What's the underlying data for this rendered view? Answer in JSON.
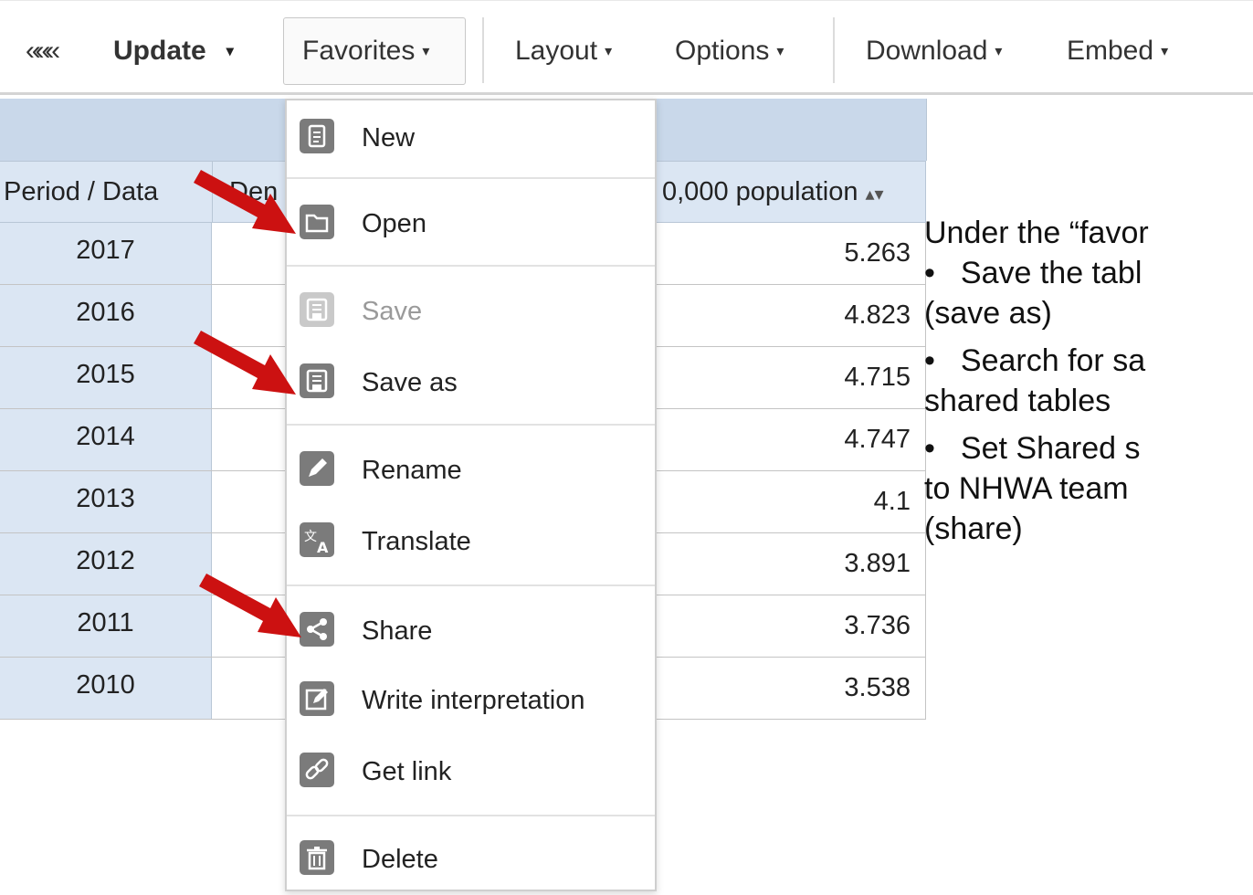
{
  "toolbar": {
    "collapse_glyph": "«««",
    "update": "Update",
    "favorites": "Favorites",
    "layout": "Layout",
    "options": "Options",
    "download": "Download",
    "embed": "Embed",
    "caret": "▾"
  },
  "table": {
    "header_period": "Period / Data",
    "header_mid_partial": "Den",
    "header_value_partial": "0,000 population",
    "sort_icon": "sort-icon",
    "rows": [
      {
        "year": "2017",
        "value": "5.263"
      },
      {
        "year": "2016",
        "value": "4.823"
      },
      {
        "year": "2015",
        "value": "4.715"
      },
      {
        "year": "2014",
        "value": "4.747"
      },
      {
        "year": "2013",
        "value": "4.1"
      },
      {
        "year": "2012",
        "value": "3.891"
      },
      {
        "year": "2011",
        "value": "3.736"
      },
      {
        "year": "2010",
        "value": "3.538"
      }
    ]
  },
  "menu": {
    "items": [
      {
        "label": "New",
        "icon": "document-icon",
        "enabled": true
      },
      {
        "label": "Open",
        "icon": "folder-icon",
        "enabled": true
      },
      {
        "label": "Save",
        "icon": "save-icon",
        "enabled": false
      },
      {
        "label": "Save as",
        "icon": "save-as-icon",
        "enabled": true
      },
      {
        "label": "Rename",
        "icon": "pencil-icon",
        "enabled": true
      },
      {
        "label": "Translate",
        "icon": "translate-icon",
        "enabled": true
      },
      {
        "label": "Share",
        "icon": "share-icon",
        "enabled": true
      },
      {
        "label": "Write interpretation",
        "icon": "edit-box-icon",
        "enabled": true
      },
      {
        "label": "Get link",
        "icon": "link-icon",
        "enabled": true
      },
      {
        "label": "Delete",
        "icon": "trash-icon",
        "enabled": true
      }
    ]
  },
  "annotation": {
    "arrow_color": "#cc1111",
    "lines": [
      {
        "text": "Under the “favor",
        "bullet": false
      },
      {
        "text": "Save the tabl",
        "bullet": true
      },
      {
        "text": "(save as)",
        "bullet": false
      },
      {
        "text": "Search for sa",
        "bullet": true
      },
      {
        "text": "shared tables",
        "bullet": false
      },
      {
        "text": "Set Shared s",
        "bullet": true
      },
      {
        "text": "to NHWA team",
        "bullet": false
      },
      {
        "text": "(share)",
        "bullet": false
      }
    ],
    "bullet_glyph": "•"
  }
}
